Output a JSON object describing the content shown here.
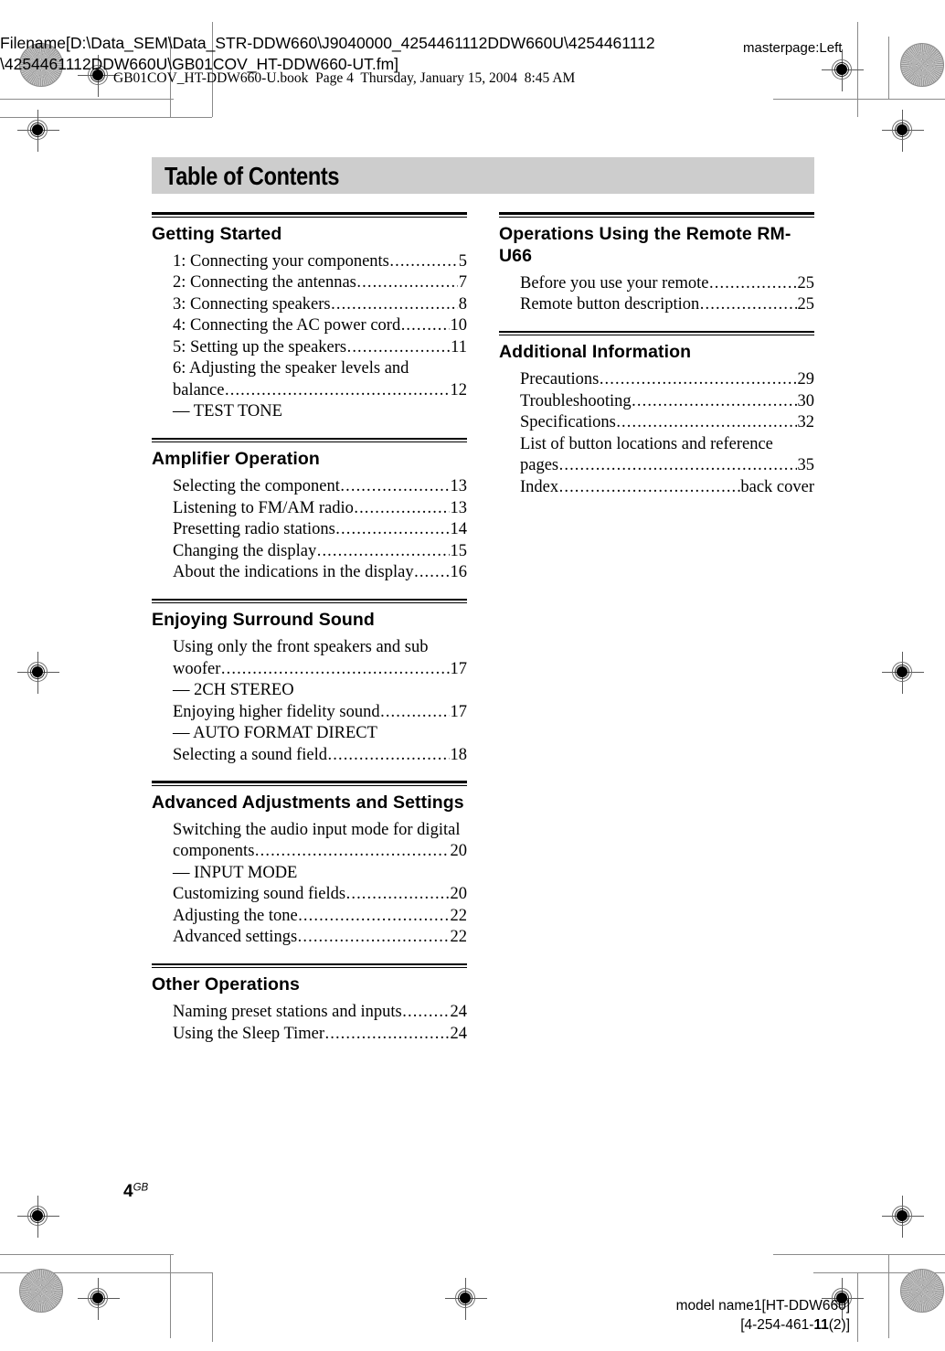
{
  "prepress": {
    "filename_overlay": "Filename[D:\\Data_SEM\\Data_STR-DDW660\\J9040000_4254461112DDW660U\\4254461112\\4254461112DDW660U\\GB01COV_HT-DDW660-UT.fm]",
    "masterpage_label": "masterpage:Left",
    "book_line": "GB01COV_HT-DDW660-U.book  Page 4  Thursday, January 15, 2004  8:45 AM",
    "model_name_line": "model name1[HT-DDW660]",
    "part_number_prefix": "[4-254-461-",
    "part_number_bold": "11",
    "part_number_suffix": "(2)]"
  },
  "page": {
    "banner_title": "Table of Contents",
    "folio_number": "4",
    "folio_suffix": "GB"
  },
  "columns": [
    {
      "sections": [
        {
          "title": "Getting Started",
          "entries": [
            {
              "type": "leader",
              "label": "1: Connecting your components",
              "page": "5"
            },
            {
              "type": "leader",
              "label": "2: Connecting the antennas",
              "page": "7"
            },
            {
              "type": "leader",
              "label": "3: Connecting speakers",
              "page": "8"
            },
            {
              "type": "leader",
              "label": "4: Connecting the AC power cord",
              "page": "10"
            },
            {
              "type": "leader",
              "label": "5: Setting up the speakers",
              "page": "11"
            },
            {
              "type": "plain",
              "label": "6: Adjusting the speaker levels and"
            },
            {
              "type": "leader",
              "indent": true,
              "label": "balance",
              "page": "12"
            },
            {
              "type": "sub",
              "label": "— TEST TONE"
            }
          ]
        },
        {
          "title": "Amplifier Operation",
          "entries": [
            {
              "type": "leader",
              "label": "Selecting the component",
              "page": "13"
            },
            {
              "type": "leader",
              "label": "Listening to FM/AM radio",
              "page": "13"
            },
            {
              "type": "leader",
              "label": "Presetting radio stations",
              "page": "14"
            },
            {
              "type": "leader",
              "label": "Changing the display",
              "page": "15"
            },
            {
              "type": "leader",
              "label": "About the indications in the display",
              "page": "16"
            }
          ]
        },
        {
          "title": "Enjoying Surround Sound",
          "entries": [
            {
              "type": "plain",
              "label": "Using only the front speakers and sub"
            },
            {
              "type": "leader",
              "indent": true,
              "label": "woofer",
              "page": "17"
            },
            {
              "type": "sub",
              "label": "— 2CH STEREO"
            },
            {
              "type": "leader",
              "label": "Enjoying higher fidelity sound",
              "page": "17"
            },
            {
              "type": "sub",
              "label": "— AUTO FORMAT DIRECT"
            },
            {
              "type": "leader",
              "label": "Selecting a sound field",
              "page": "18"
            }
          ]
        },
        {
          "title": "Advanced Adjustments and Settings",
          "entries": [
            {
              "type": "plain",
              "label": "Switching the audio input mode for digital"
            },
            {
              "type": "leader",
              "indent": true,
              "label": "components",
              "page": "20"
            },
            {
              "type": "sub",
              "label": "— INPUT MODE"
            },
            {
              "type": "leader",
              "label": "Customizing sound fields",
              "page": "20"
            },
            {
              "type": "leader",
              "label": "Adjusting the tone",
              "page": "22"
            },
            {
              "type": "leader",
              "label": "Advanced settings",
              "page": "22"
            }
          ]
        },
        {
          "title": "Other Operations",
          "entries": [
            {
              "type": "leader",
              "label": "Naming preset stations and inputs",
              "page": "24"
            },
            {
              "type": "leader",
              "label": "Using the Sleep Timer",
              "page": "24"
            }
          ]
        }
      ]
    },
    {
      "sections": [
        {
          "title": "Operations Using the Remote RM-U66",
          "entries": [
            {
              "type": "leader",
              "label": "Before you use your remote",
              "page": "25"
            },
            {
              "type": "leader",
              "label": "Remote button description",
              "page": "25"
            }
          ]
        },
        {
          "title": "Additional Information",
          "entries": [
            {
              "type": "leader",
              "label": "Precautions",
              "page": "29"
            },
            {
              "type": "leader",
              "label": "Troubleshooting",
              "page": "30"
            },
            {
              "type": "leader",
              "label": "Specifications",
              "page": "32"
            },
            {
              "type": "plain",
              "label": "List of button locations and reference"
            },
            {
              "type": "leader",
              "indent": true,
              "label": "pages",
              "page": "35"
            },
            {
              "type": "leader",
              "label": "Index",
              "page": "back cover"
            }
          ]
        }
      ]
    }
  ]
}
